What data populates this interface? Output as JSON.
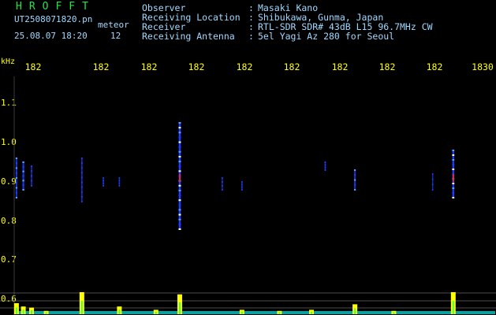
{
  "header": {
    "logo": "HROFFT",
    "file_name": "UT2508071820.pn",
    "type_label": "meteor",
    "datetime": "25.08.07 18:20",
    "count": "12"
  },
  "station_info": [
    {
      "label": "Observer",
      "value": "Masaki Kano"
    },
    {
      "label": "Receiving Location",
      "value": "Shibukawa, Gunma, Japan"
    },
    {
      "label": "Receiver",
      "value": "RTL-SDR SDR# 43dB L15 96.7MHz CW"
    },
    {
      "label": "Receiving Antenna",
      "value": "5el Yagi Az 280 for Seoul"
    }
  ],
  "chart_data": {
    "type": "heatmap",
    "ylabel": "kHz",
    "x_tick_labels": [
      "182",
      "182",
      "182",
      "182",
      "182",
      "182",
      "182",
      "182",
      "182",
      "1830"
    ],
    "y_tick_labels": [
      "1.1",
      "1.0",
      "0.9",
      "0.8",
      "0.7",
      "0.6"
    ],
    "y_ticks": [
      1.1,
      1.0,
      0.9,
      0.8,
      0.7,
      0.6
    ],
    "ylim": [
      0.58,
      1.15
    ],
    "xlim": [
      1820.0,
      1830.0
    ],
    "colors": {
      "background": "#000000",
      "text": "#9fd9ff",
      "tick_text": "#ffff00",
      "logo": "#28e04a",
      "echo_low": "#1f3cff",
      "echo_mid": "#5aa0ff",
      "echo_high": "#e02a50",
      "level_bars": "#ffff00",
      "baseline": "#00d0d0"
    },
    "echoes": [
      {
        "t": 1820.05,
        "f_low": 0.86,
        "f_high": 0.96,
        "strength": 0.6
      },
      {
        "t": 1820.2,
        "f_low": 0.88,
        "f_high": 0.95,
        "strength": 0.7
      },
      {
        "t": 1820.38,
        "f_low": 0.89,
        "f_high": 0.94,
        "strength": 0.4
      },
      {
        "t": 1821.48,
        "f_low": 0.85,
        "f_high": 0.96,
        "strength": 0.4
      },
      {
        "t": 1821.95,
        "f_low": 0.89,
        "f_high": 0.91,
        "strength": 0.3
      },
      {
        "t": 1822.3,
        "f_low": 0.89,
        "f_high": 0.91,
        "strength": 0.3
      },
      {
        "t": 1823.62,
        "f_low": 0.78,
        "f_high": 1.05,
        "strength": 1.0
      },
      {
        "t": 1824.55,
        "f_low": 0.88,
        "f_high": 0.91,
        "strength": 0.3
      },
      {
        "t": 1824.98,
        "f_low": 0.88,
        "f_high": 0.9,
        "strength": 0.3
      },
      {
        "t": 1826.8,
        "f_low": 0.93,
        "f_high": 0.95,
        "strength": 0.4
      },
      {
        "t": 1827.45,
        "f_low": 0.88,
        "f_high": 0.93,
        "strength": 0.6
      },
      {
        "t": 1829.15,
        "f_low": 0.88,
        "f_high": 0.92,
        "strength": 0.3
      },
      {
        "t": 1829.6,
        "f_low": 0.86,
        "f_high": 0.98,
        "strength": 0.9
      }
    ],
    "level_bars": [
      {
        "t": 1820.05,
        "level": 0.5
      },
      {
        "t": 1820.2,
        "level": 0.35
      },
      {
        "t": 1820.38,
        "level": 0.3
      },
      {
        "t": 1820.7,
        "level": 0.15
      },
      {
        "t": 1821.48,
        "level": 1.0
      },
      {
        "t": 1822.3,
        "level": 0.35
      },
      {
        "t": 1823.1,
        "level": 0.2
      },
      {
        "t": 1823.62,
        "level": 0.9
      },
      {
        "t": 1824.98,
        "level": 0.2
      },
      {
        "t": 1825.8,
        "level": 0.15
      },
      {
        "t": 1826.5,
        "level": 0.2
      },
      {
        "t": 1827.45,
        "level": 0.45
      },
      {
        "t": 1828.3,
        "level": 0.15
      },
      {
        "t": 1829.6,
        "level": 1.0
      }
    ]
  }
}
